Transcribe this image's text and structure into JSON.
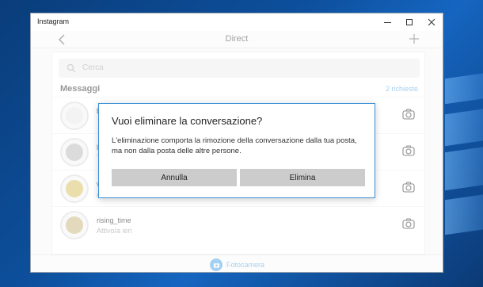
{
  "window": {
    "title": "Instagram"
  },
  "header": {
    "title": "Direct"
  },
  "search": {
    "placeholder": "Cerca"
  },
  "messages": {
    "section_label": "Messaggi",
    "requests_label": "2 richieste",
    "rows": [
      {
        "username": "b",
        "status": ""
      },
      {
        "username": "li",
        "status": "T"
      },
      {
        "username": "vi",
        "status": "A"
      },
      {
        "username": "rising_time",
        "status": "Attivo/a ieri"
      }
    ]
  },
  "bottom": {
    "camera_label": "Fotocamera"
  },
  "dialog": {
    "title": "Vuoi eliminare la conversazione?",
    "message": "L'eliminazione comporta la rimozione della conversazione dalla tua posta, ma non dalla posta delle altre persone.",
    "cancel_label": "Annulla",
    "delete_label": "Elimina"
  },
  "colors": {
    "accent": "#3b8fd6",
    "link": "#5aa9e6",
    "desktop": "#0d4f9c"
  },
  "icons": [
    "back-arrow-icon",
    "plus-icon",
    "search-icon",
    "camera-icon",
    "minimize-icon",
    "maximize-icon",
    "close-icon"
  ]
}
